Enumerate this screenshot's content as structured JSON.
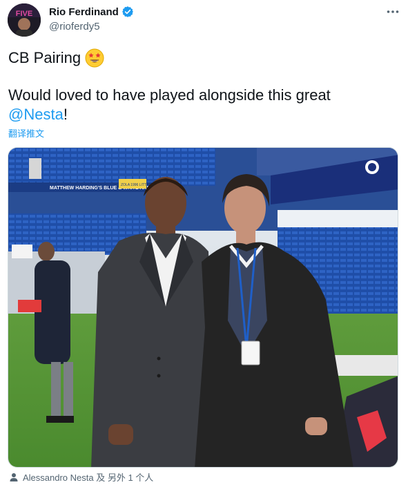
{
  "author": {
    "display_name": "Rio Ferdinand",
    "handle": "@rioferdy5",
    "avatar_text": "FIVE"
  },
  "tweet": {
    "line1": "CB Pairing",
    "line1_emoji": "star-struck-emoji",
    "line2_prefix": "Would loved to have played alongside this great",
    "mention": "@Nesta",
    "line2_suffix": "!",
    "translate_label": "翻译推文"
  },
  "photo": {
    "stand_banner": "MATTHEW HARDING'S BLUE & WHITE ARMY",
    "stand_banner_small": "ZOLA 1996 LITTLE MAGIC",
    "alt": "Rio Ferdinand and Alessandro Nesta in suits pitchside at a football stadium"
  },
  "tagged": {
    "text": "Alessandro Nesta 及 另外 1 个人"
  },
  "colors": {
    "accent": "#1d9bf0",
    "text": "#0f1419",
    "muted": "#536471"
  },
  "icons": {
    "more": "more-options-icon",
    "verified": "verified-badge-icon",
    "tag": "person-icon"
  }
}
